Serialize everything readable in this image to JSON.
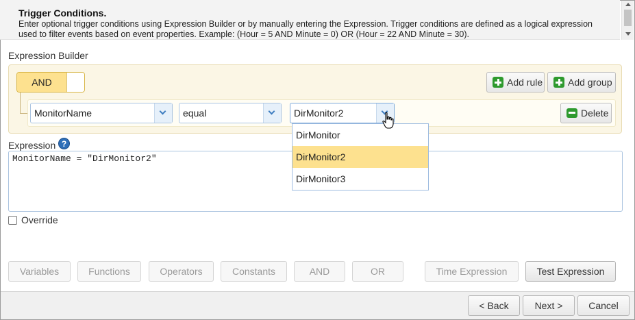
{
  "header": {
    "title": "Trigger Conditions.",
    "description": "Enter optional trigger conditions using Expression Builder or by manually entering the Expression. Trigger conditions are defined as a logical expression used to filter events based on event properties. Example: (Hour = 5 AND Minute = 0) OR (Hour = 22 AND Minute = 30)."
  },
  "builder": {
    "section_label": "Expression Builder",
    "conjunction": "AND",
    "add_rule_label": "Add rule",
    "add_group_label": "Add group",
    "rule": {
      "field": "MonitorName",
      "operator": "equal",
      "value": "DirMonitor2",
      "delete_label": "Delete"
    },
    "dropdown_options": [
      "DirMonitor",
      "DirMonitor2",
      "DirMonitor3"
    ],
    "dropdown_selected": "DirMonitor2"
  },
  "expression": {
    "label": "Expression",
    "help_glyph": "?",
    "text": "MonitorName = \"DirMonitor2\""
  },
  "override": {
    "label": "Override",
    "checked": false
  },
  "tools": {
    "variables": "Variables",
    "functions": "Functions",
    "operators": "Operators",
    "constants": "Constants",
    "and": "AND",
    "or": "OR",
    "time_expression": "Time Expression",
    "test_expression": "Test Expression"
  },
  "footer": {
    "back": "< Back",
    "next": "Next >",
    "cancel": "Cancel"
  },
  "colors": {
    "accent_yellow": "#fde18f",
    "builder_bg": "#fbf6e5",
    "icon_green": "#2e9a2e",
    "help_blue": "#2f6fb8"
  }
}
